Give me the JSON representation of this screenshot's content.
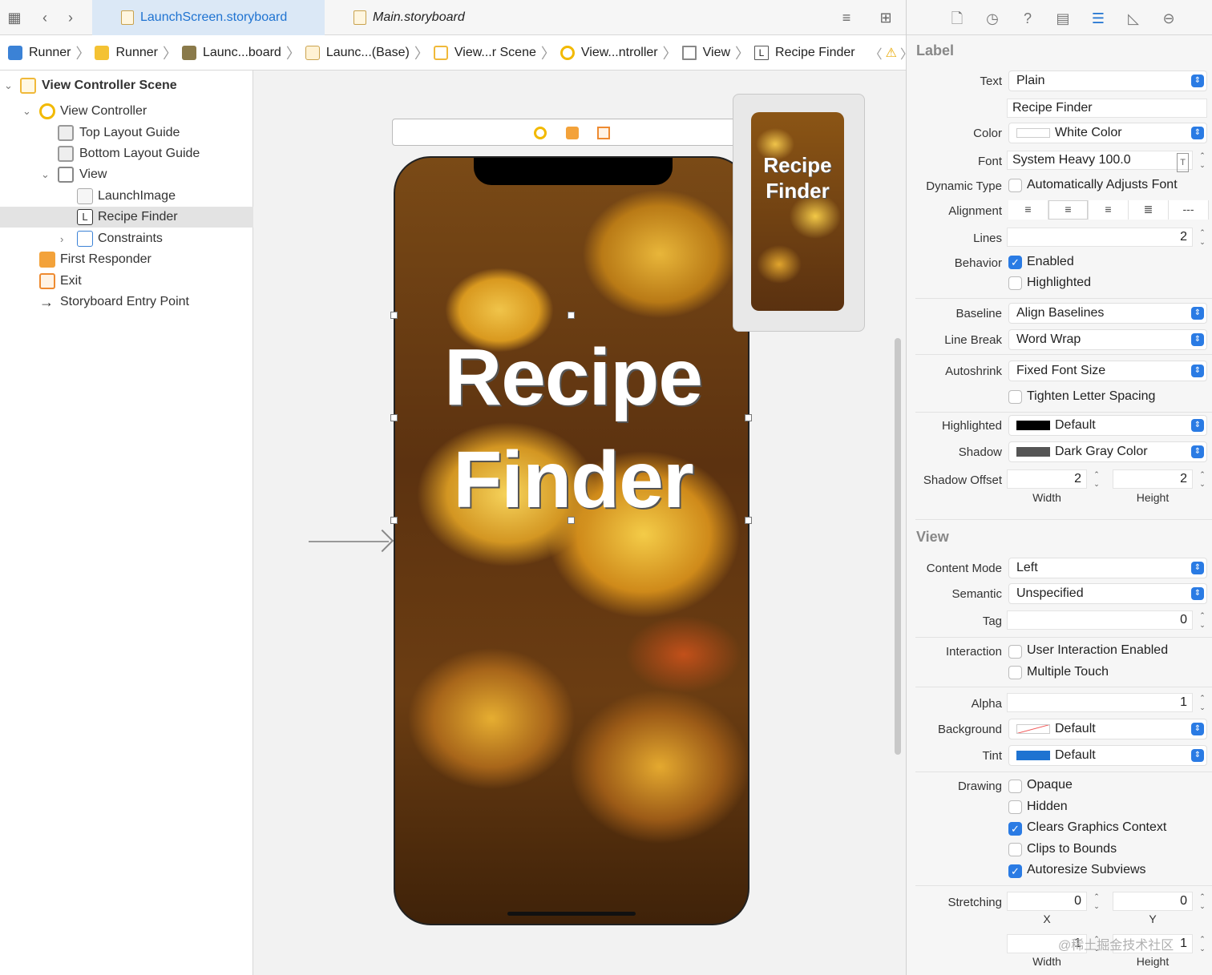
{
  "tabs": [
    {
      "label": "LaunchScreen.storyboard",
      "active": true
    },
    {
      "label": "Main.storyboard",
      "active": false
    }
  ],
  "breadcrumbs": [
    {
      "label": "Runner",
      "icon": "project-icon"
    },
    {
      "label": "Runner",
      "icon": "folder-icon"
    },
    {
      "label": "Launc...board",
      "icon": "storyboard-icon"
    },
    {
      "label": "Launc...(Base)",
      "icon": "storyboard-icon"
    },
    {
      "label": "View...r Scene",
      "icon": "scene-icon"
    },
    {
      "label": "View...ntroller",
      "icon": "view-controller-icon"
    },
    {
      "label": "View",
      "icon": "view-icon"
    },
    {
      "label": "Recipe Finder",
      "icon": "label-icon"
    }
  ],
  "outline": [
    {
      "label": "View Controller Scene",
      "level": 0,
      "expanded": true,
      "icon": "scene-icon",
      "bold": true
    },
    {
      "label": "View Controller",
      "level": 1,
      "expanded": true,
      "icon": "view-controller-icon"
    },
    {
      "label": "Top Layout Guide",
      "level": 2,
      "icon": "layout-guide-icon"
    },
    {
      "label": "Bottom Layout Guide",
      "level": 2,
      "icon": "layout-guide-icon"
    },
    {
      "label": "View",
      "level": 2,
      "expanded": true,
      "icon": "view-icon"
    },
    {
      "label": "LaunchImage",
      "level": 3,
      "icon": "image-view-icon"
    },
    {
      "label": "Recipe Finder",
      "level": 3,
      "icon": "label-icon",
      "selected": true
    },
    {
      "label": "Constraints",
      "level": 3,
      "expanded": false,
      "icon": "constraints-icon"
    },
    {
      "label": "First Responder",
      "level": 1,
      "icon": "first-responder-icon"
    },
    {
      "label": "Exit",
      "level": 1,
      "icon": "exit-icon"
    },
    {
      "label": "Storyboard Entry Point",
      "level": 1,
      "icon": "entry-arrow-icon"
    }
  ],
  "canvas": {
    "title_line1": "Recipe",
    "title_line2": "Finder",
    "preview_line1": "Recipe",
    "preview_line2": "Finder"
  },
  "inspector": {
    "label_section": "Label",
    "text_label": "Text",
    "text_value": "Plain",
    "text_content": "Recipe Finder",
    "color_label": "Color",
    "color_value": "White Color",
    "font_label": "Font",
    "font_value": "System Heavy 100.0",
    "dynamic_label": "Dynamic Type",
    "dynamic_value": "Automatically Adjusts Font",
    "alignment_label": "Alignment",
    "lines_label": "Lines",
    "lines_value": "2",
    "behavior_label": "Behavior",
    "enabled_label": "Enabled",
    "highlighted_label": "Highlighted",
    "baseline_label": "Baseline",
    "baseline_value": "Align Baselines",
    "linebreak_label": "Line Break",
    "linebreak_value": "Word Wrap",
    "autoshrink_label": "Autoshrink",
    "autoshrink_value": "Fixed Font Size",
    "tighten_label": "Tighten Letter Spacing",
    "hl_label": "Highlighted",
    "hl_value": "Default",
    "shadow_label": "Shadow",
    "shadow_value": "Dark Gray Color",
    "shadow_offset_label": "Shadow Offset",
    "shadow_w": "2",
    "shadow_h": "2",
    "width_label": "Width",
    "height_label": "Height",
    "view_section": "View",
    "content_mode_label": "Content Mode",
    "content_mode_value": "Left",
    "semantic_label": "Semantic",
    "semantic_value": "Unspecified",
    "tag_label": "Tag",
    "tag_value": "0",
    "interaction_label": "Interaction",
    "uie_label": "User Interaction Enabled",
    "mt_label": "Multiple Touch",
    "alpha_label": "Alpha",
    "alpha_value": "1",
    "background_label": "Background",
    "background_value": "Default",
    "tint_label": "Tint",
    "tint_value": "Default",
    "drawing_label": "Drawing",
    "opaque_label": "Opaque",
    "hidden_label": "Hidden",
    "clears_label": "Clears Graphics Context",
    "clips_label": "Clips to Bounds",
    "autoresize_label": "Autoresize Subviews",
    "stretching_label": "Stretching",
    "stretch_x": "0",
    "stretch_y": "0",
    "x_label": "X",
    "y_label": "Y",
    "stretch_w": "1",
    "stretch_h": "1"
  },
  "watermark": "@稀土掘金技术社区",
  "colors": {
    "accent": "#1f73d1",
    "white_swatch": "#ffffff",
    "black_swatch": "#000000",
    "darkgray_swatch": "#555555",
    "tint_swatch": "#1f73d1"
  }
}
